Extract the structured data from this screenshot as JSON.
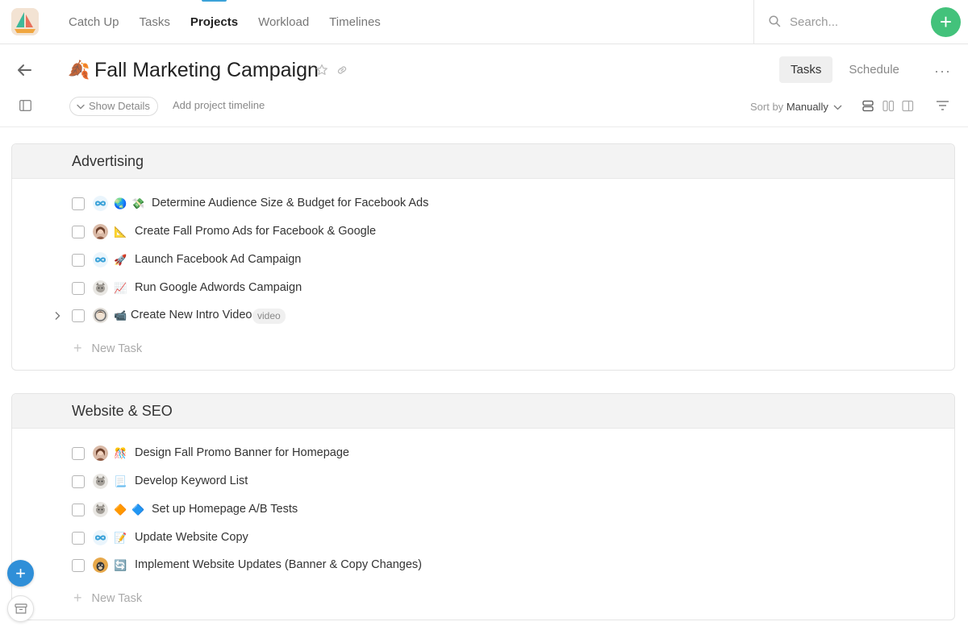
{
  "nav": {
    "items": [
      "Catch Up",
      "Tasks",
      "Projects",
      "Workload",
      "Timelines"
    ],
    "active": "Projects"
  },
  "search": {
    "placeholder": "Search..."
  },
  "add_button": "+",
  "project": {
    "emoji": "🍂",
    "title": "Fall Marketing Campaign",
    "view_tabs": [
      "Tasks",
      "Schedule"
    ],
    "active_view": "Tasks",
    "more": "···"
  },
  "toolbar": {
    "show_details": "Show Details",
    "add_timeline": "Add project timeline",
    "sort_prefix": "Sort by",
    "sort_value": "Manually"
  },
  "sections": [
    {
      "title": "Advertising",
      "tasks": [
        {
          "avatar": "loop-avatar",
          "emojis": [
            "🌏",
            "💸"
          ],
          "name": "Determine Audience Size & Budget for Facebook Ads"
        },
        {
          "avatar": "person-avatar",
          "emojis": [
            "📐"
          ],
          "name": "Create Fall Promo Ads for Facebook & Google"
        },
        {
          "avatar": "loop-avatar",
          "emojis": [
            "🚀"
          ],
          "name": "Launch Facebook Ad Campaign"
        },
        {
          "avatar": "cat-avatar",
          "emojis": [
            "📈"
          ],
          "name": "Run Google Adwords Campaign"
        },
        {
          "avatar": "person-avatar",
          "emojis": [
            "📹"
          ],
          "name": "Create New Intro Video",
          "tag": "video",
          "has_subtasks": true
        }
      ],
      "new_task": "New Task"
    },
    {
      "title": "Website & SEO",
      "tasks": [
        {
          "avatar": "person-avatar",
          "emojis": [
            "🎊"
          ],
          "name": "Design Fall Promo Banner for Homepage"
        },
        {
          "avatar": "cat-avatar",
          "emojis": [
            "📃"
          ],
          "name": "Develop Keyword List"
        },
        {
          "avatar": "cat-avatar",
          "emojis": [
            "🔶",
            "🔷"
          ],
          "name": "Set up Homepage A/B Tests"
        },
        {
          "avatar": "loop-avatar",
          "emojis": [
            "📝"
          ],
          "name": "Update Website Copy"
        },
        {
          "avatar": "dog-avatar",
          "emojis": [
            "🔄"
          ],
          "name": "Implement Website Updates (Banner & Copy Changes)"
        }
      ],
      "new_task": "New Task"
    }
  ],
  "colors": {
    "accent": "#3ba2d8",
    "add": "#43c27b",
    "fab": "#2f8fd8"
  }
}
